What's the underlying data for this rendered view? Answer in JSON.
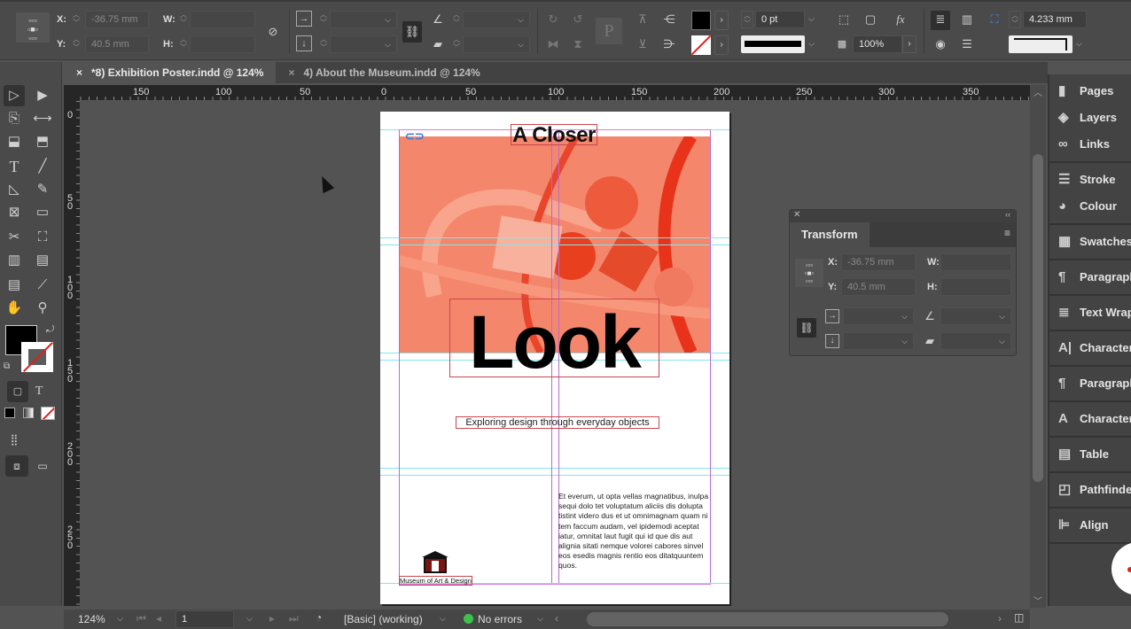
{
  "control_bar": {
    "x_label": "X:",
    "x_value": "-36.75 mm",
    "y_label": "Y:",
    "y_value": "40.5 mm",
    "w_label": "W:",
    "w_value": "",
    "h_label": "H:",
    "h_value": "",
    "stroke_weight": "0 pt",
    "opacity": "100%",
    "gap_value": "4.233 mm",
    "fill_color": "#000000"
  },
  "tabs": [
    {
      "label": "*8) Exhibition Poster.indd @ 124%",
      "close": "×",
      "active": true
    },
    {
      "label": "4) About the Museum.indd @ 124%",
      "close": "×",
      "active": false
    }
  ],
  "ruler": {
    "h_ticks": [
      "150",
      "100",
      "50",
      "0",
      "50",
      "100",
      "150",
      "200",
      "250",
      "300",
      "350"
    ],
    "v_ticks": [
      "0",
      "5\n0",
      "1\n0\n0",
      "1\n5\n0",
      "2\n0\n0",
      "2\n5\n0"
    ]
  },
  "document": {
    "title_small": "A Closer",
    "title_big": "Look",
    "subtitle": "Exploring design through everyday objects",
    "body": "Et everum, ut opta vellas magnatibus, inulpa sequi dolo tet voluptatum aliciis dis dolupta tistint videro dus et ut omnimagnam quam ni tem faccum audam, vel ipidemodi aceptat iatur, omnitat laut fugit qui id que dis aut alignia sitati nemque volorei cabores sinvel eos esedis magnis rentio eos ditatquuntem quos.",
    "logo_caption": "Museum of Art & Design",
    "image_tint": "#f4866c",
    "accent_red": "#e8321a"
  },
  "transform_panel": {
    "title": "Transform",
    "x_label": "X:",
    "x_value": "-36.75 mm",
    "y_label": "Y:",
    "y_value": "40.5 mm",
    "w_label": "W:",
    "h_label": "H:"
  },
  "dock": {
    "groups": [
      [
        {
          "icon": "pages-icon",
          "glyph": "▮",
          "label": "Pages"
        },
        {
          "icon": "layers-icon",
          "glyph": "◈",
          "label": "Layers"
        },
        {
          "icon": "links-icon",
          "glyph": "∞",
          "label": "Links"
        }
      ],
      [
        {
          "icon": "stroke-icon",
          "glyph": "☰",
          "label": "Stroke"
        },
        {
          "icon": "colour-icon",
          "glyph": "◕",
          "label": "Colour"
        }
      ],
      [
        {
          "icon": "swatches-icon",
          "glyph": "▦",
          "label": "Swatches"
        }
      ],
      [
        {
          "icon": "paragraph-icon",
          "glyph": "¶",
          "label": "Paragraph"
        }
      ],
      [
        {
          "icon": "text-wrap-icon",
          "glyph": "≣",
          "label": "Text Wrap"
        }
      ],
      [
        {
          "icon": "character-icon",
          "glyph": "A|",
          "label": "Character"
        }
      ],
      [
        {
          "icon": "paragraph-styles-icon",
          "glyph": "¶",
          "label": "Paragraph Styles"
        }
      ],
      [
        {
          "icon": "character-styles-icon",
          "glyph": "A",
          "label": "Character Styles"
        }
      ],
      [
        {
          "icon": "table-icon",
          "glyph": "▤",
          "label": "Table"
        }
      ],
      [
        {
          "icon": "pathfinder-icon",
          "glyph": "◰",
          "label": "Pathfinder"
        }
      ],
      [
        {
          "icon": "align-icon",
          "glyph": "⊫",
          "label": "Align"
        }
      ]
    ]
  },
  "status_bar": {
    "zoom": "124%",
    "page": "1",
    "preflight_profile": "[Basic] (working)",
    "errors": "No errors",
    "status_color": "#3cc24a"
  }
}
